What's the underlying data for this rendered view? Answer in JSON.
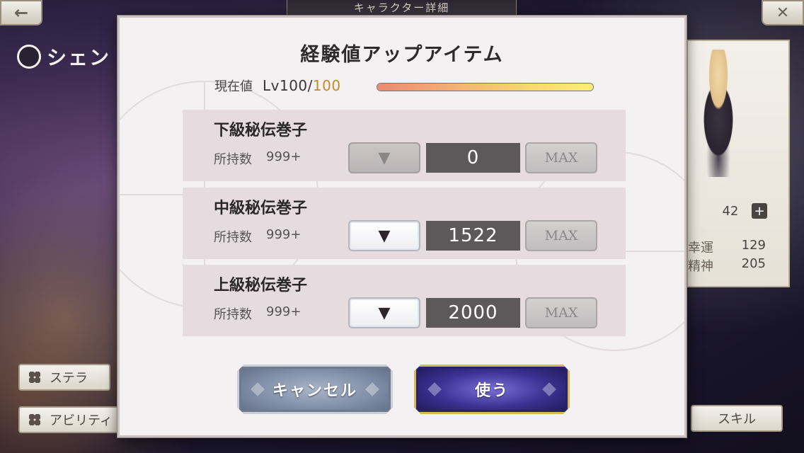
{
  "background": {
    "screen_title": "キャラクター詳細",
    "back_icon": "←",
    "close_icon": "✕",
    "character_name": "シェン",
    "level_partial": "42",
    "stats": [
      {
        "label": "幸運",
        "value": "129"
      },
      {
        "label": "精神",
        "value": "205"
      }
    ],
    "left_buttons": [
      {
        "label": "ステラ"
      },
      {
        "label": "アビリティ"
      }
    ],
    "skill_label": "スキル"
  },
  "dialog": {
    "title": "経験値アップアイテム",
    "current_label": "現在値",
    "level_text": "Lv100/",
    "level_max": "100",
    "progress": 1.0,
    "items": [
      {
        "name": "下級秘伝巻子",
        "own_label": "所持数",
        "own_count": "999+",
        "quantity": "0",
        "decrement_enabled": false,
        "decrement_symbol": "▼",
        "max_label": "MAX"
      },
      {
        "name": "中級秘伝巻子",
        "own_label": "所持数",
        "own_count": "999+",
        "quantity": "1522",
        "decrement_enabled": true,
        "decrement_symbol": "▼",
        "max_label": "MAX"
      },
      {
        "name": "上級秘伝巻子",
        "own_label": "所持数",
        "own_count": "999+",
        "quantity": "2000",
        "decrement_enabled": true,
        "decrement_symbol": "▼",
        "max_label": "MAX"
      }
    ],
    "cancel_label": "キャンセル",
    "use_label": "使う"
  },
  "colors": {
    "progress_start": "#e98a70",
    "progress_end": "#fbee78",
    "level_max": "#c28a2a",
    "use_button": "#3c3294",
    "cancel_button": "#7f8da6"
  }
}
